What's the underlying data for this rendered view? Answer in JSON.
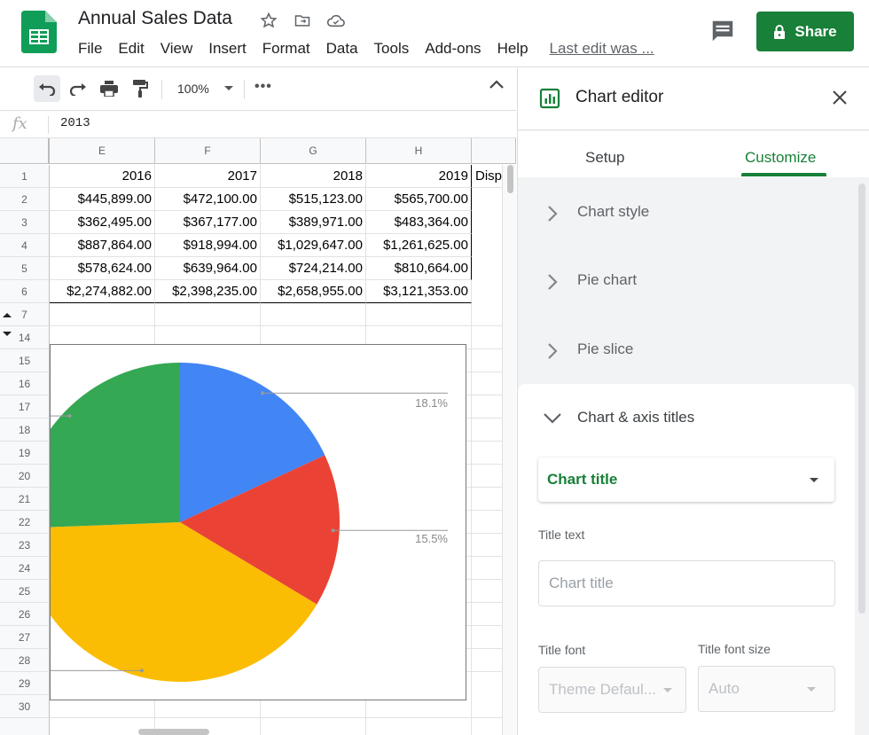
{
  "app": {
    "doc_title": "Annual Sales Data",
    "menu": [
      "File",
      "Edit",
      "View",
      "Insert",
      "Format",
      "Data",
      "Tools",
      "Add-ons",
      "Help"
    ],
    "last_edit": "Last edit was ...",
    "share_label": "Share",
    "brand_color": "#188038"
  },
  "toolbar": {
    "zoom": "100%",
    "more": "•••"
  },
  "formula_bar": {
    "fx": "fx",
    "value": "2013"
  },
  "sheet": {
    "columns": [
      "E",
      "F",
      "G",
      "H"
    ],
    "rows": [
      {
        "num": "1",
        "cells": [
          "2016",
          "2017",
          "2018",
          "2019"
        ],
        "extra": "Disp"
      },
      {
        "num": "2",
        "cells": [
          "$445,899.00",
          "$472,100.00",
          "$515,123.00",
          "$565,700.00"
        ]
      },
      {
        "num": "3",
        "cells": [
          "$362,495.00",
          "$367,177.00",
          "$389,971.00",
          "$483,364.00"
        ]
      },
      {
        "num": "4",
        "cells": [
          "$887,864.00",
          "$918,994.00",
          "$1,029,647.00",
          "$1,261,625.00"
        ]
      },
      {
        "num": "5",
        "cells": [
          "$578,624.00",
          "$639,964.00",
          "$724,214.00",
          "$810,664.00"
        ]
      },
      {
        "num": "6",
        "cells": [
          "$2,274,882.00",
          "$2,398,235.00",
          "$2,658,955.00",
          "$3,121,353.00"
        ]
      }
    ],
    "row_numbers_below": [
      "7",
      "14",
      "15",
      "16",
      "17",
      "18",
      "19",
      "20",
      "21",
      "22",
      "23",
      "24",
      "25",
      "26",
      "27",
      "28",
      "29",
      "30"
    ]
  },
  "chart_data": {
    "type": "pie",
    "slices": [
      {
        "value": 18.1,
        "color": "#4285f4"
      },
      {
        "value": 15.5,
        "color": "#ea4335"
      },
      {
        "value": 40.8,
        "color": "#fbbc04"
      },
      {
        "value": 25.6,
        "color": "#34a853"
      }
    ],
    "data_labels": [
      "18.1%",
      "15.5%"
    ]
  },
  "editor": {
    "title": "Chart editor",
    "tabs": [
      "Setup",
      "Customize"
    ],
    "active_tab": "Customize",
    "sections": [
      "Chart style",
      "Pie chart",
      "Pie slice"
    ],
    "open_section": "Chart & axis titles",
    "title_select": "Chart title",
    "title_text_label": "Title text",
    "title_text_placeholder": "Chart title",
    "title_font_label": "Title font",
    "title_font_value": "Theme Defaul...",
    "title_font_size_label": "Title font size",
    "title_font_size_value": "Auto"
  }
}
